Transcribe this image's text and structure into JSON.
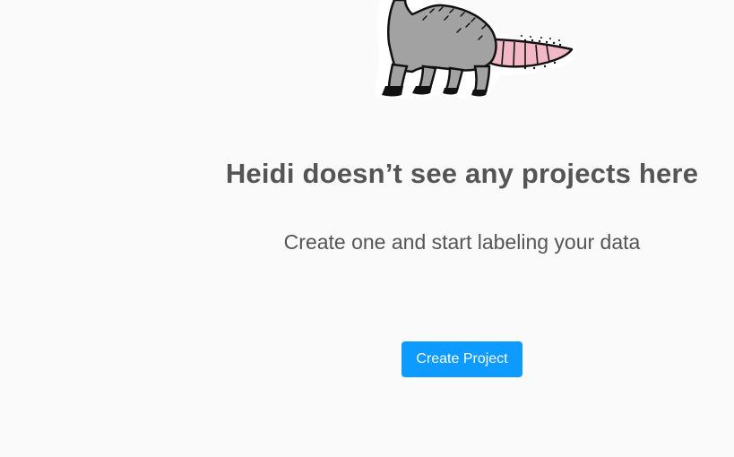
{
  "empty_state": {
    "illustration": "opossum-illustration",
    "title": "Heidi doesn’t see any projects here",
    "subtitle": "Create one and start labeling your data",
    "create_button_label": "Create Project"
  },
  "colors": {
    "background": "#fafafa",
    "text": "#555555",
    "primary_button": "#0d9bff",
    "opossum_body": "#a2a2a2",
    "opossum_tail": "#f2b8c6"
  }
}
